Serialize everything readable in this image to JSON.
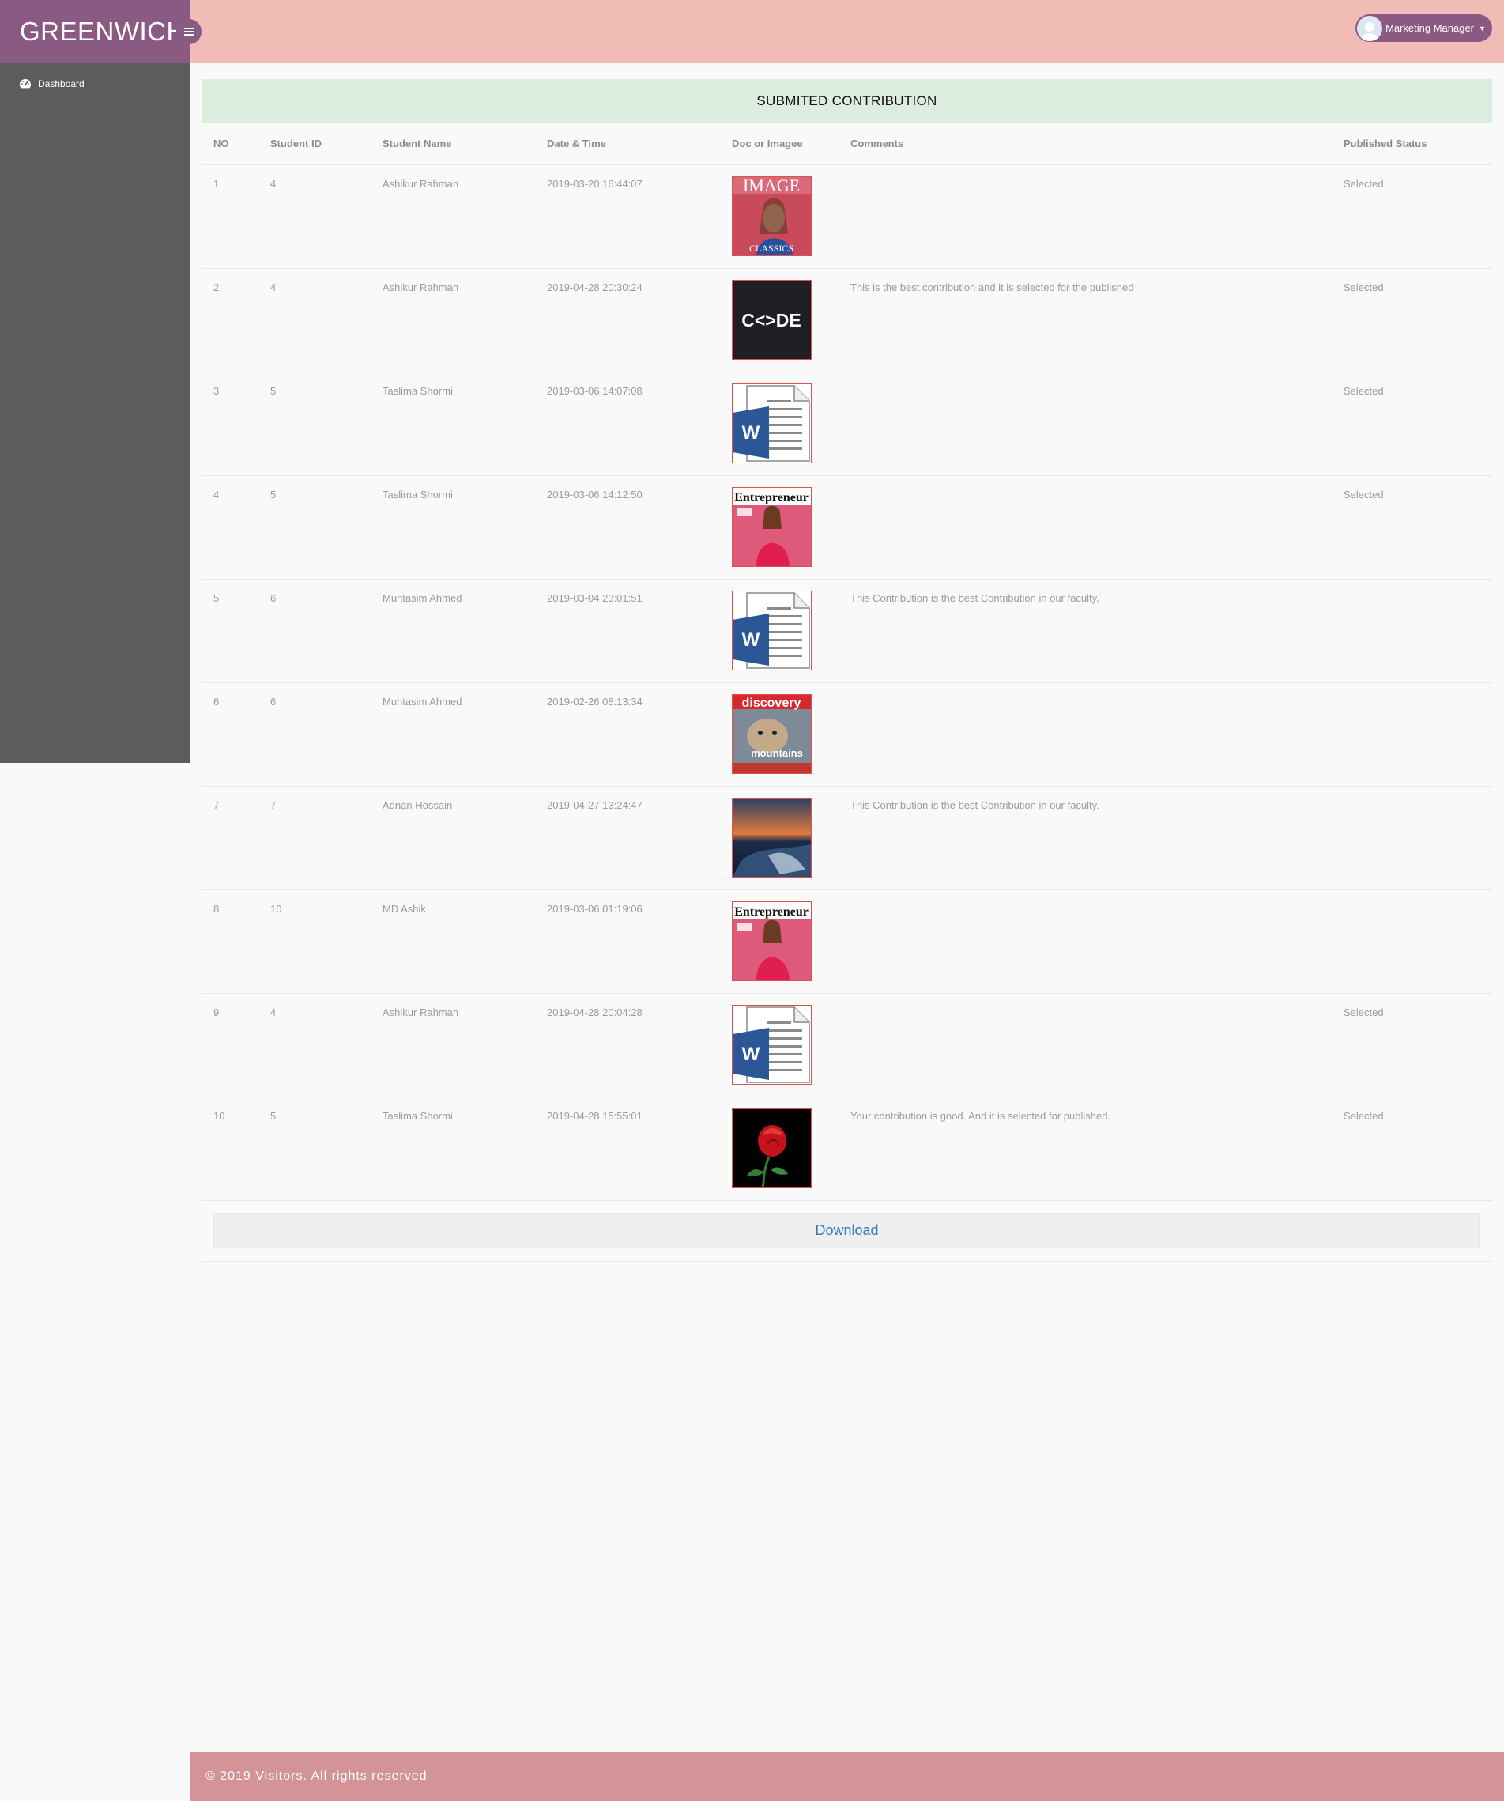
{
  "brand": {
    "title": "GREENWICH"
  },
  "sidebar": {
    "items": [
      {
        "label": "Dashboard",
        "icon": "dashboard-icon"
      }
    ]
  },
  "topbar": {
    "user_label": "Marketing Manager"
  },
  "panel": {
    "title": "SUBMITED CONTRIBUTION"
  },
  "table": {
    "headers": [
      "NO",
      "Student ID",
      "Student Name",
      "Date & Time",
      "Doc or Imagee",
      "Comments",
      "Published Status"
    ],
    "rows": [
      {
        "no": "1",
        "student_id": "4",
        "name": "Ashikur Rahman",
        "datetime": "2019-03-20 16:44:07",
        "thumb": "magazine-image-classics",
        "thumb_text": "IMAGE",
        "thumb_sub": "CLASSICS",
        "comment": "",
        "status": "Selected"
      },
      {
        "no": "2",
        "student_id": "4",
        "name": "Ashikur Rahman",
        "datetime": "2019-04-28 20:30:24",
        "thumb": "code-logo",
        "thumb_text": "C<>DE",
        "thumb_sub": "",
        "comment": "This is the best contribution and it is selected for the published",
        "status": "Selected"
      },
      {
        "no": "3",
        "student_id": "5",
        "name": "Taslima Shormi",
        "datetime": "2019-03-06 14:07:08",
        "thumb": "word-doc",
        "thumb_text": "W",
        "thumb_sub": "",
        "comment": "",
        "status": "Selected"
      },
      {
        "no": "4",
        "student_id": "5",
        "name": "Taslima Shormi",
        "datetime": "2019-03-06 14:12:50",
        "thumb": "entrepreneur-magazine",
        "thumb_text": "Entrepreneur",
        "thumb_sub": "",
        "comment": "",
        "status": "Selected"
      },
      {
        "no": "5",
        "student_id": "6",
        "name": "Muhtasim Ahmed",
        "datetime": "2019-03-04 23:01:51",
        "thumb": "word-doc",
        "thumb_text": "W",
        "thumb_sub": "",
        "comment": "This Contribution is the best Contribution in our faculty.",
        "status": ""
      },
      {
        "no": "6",
        "student_id": "6",
        "name": "Muhtasim Ahmed",
        "datetime": "2019-02-26 08:13:34",
        "thumb": "discovery-magazine",
        "thumb_text": "discovery",
        "thumb_sub": "mountains",
        "comment": "",
        "status": ""
      },
      {
        "no": "7",
        "student_id": "7",
        "name": "Adnan Hossain",
        "datetime": "2019-04-27 13:24:47",
        "thumb": "sunset-photo",
        "thumb_text": "",
        "thumb_sub": "",
        "comment": "This Contribution is the best Contribution in our faculty.",
        "status": ""
      },
      {
        "no": "8",
        "student_id": "10",
        "name": "MD Ashik",
        "datetime": "2019-03-06 01:19:06",
        "thumb": "entrepreneur-magazine",
        "thumb_text": "Entrepreneur",
        "thumb_sub": "",
        "comment": "",
        "status": ""
      },
      {
        "no": "9",
        "student_id": "4",
        "name": "Ashikur Rahman",
        "datetime": "2019-04-28 20:04:28",
        "thumb": "word-doc",
        "thumb_text": "W",
        "thumb_sub": "",
        "comment": "",
        "status": "Selected"
      },
      {
        "no": "10",
        "student_id": "5",
        "name": "Taslima Shormi",
        "datetime": "2019-04-28 15:55:01",
        "thumb": "rose-photo",
        "thumb_text": "",
        "thumb_sub": "",
        "comment": "Your contribution is good. And it is selected for published.",
        "status": "Selected"
      }
    ]
  },
  "actions": {
    "download_label": "Download"
  },
  "footer": {
    "text": "© 2019 Visitors. All rights reserved"
  },
  "colors": {
    "brand": "#8a5a83",
    "topbar": "#f2bcb6",
    "sidebar": "#5c5c5c",
    "panel_head": "#dcede0",
    "footer": "#d49497",
    "link": "#337ab7",
    "thumb_border": "#d9534f"
  }
}
